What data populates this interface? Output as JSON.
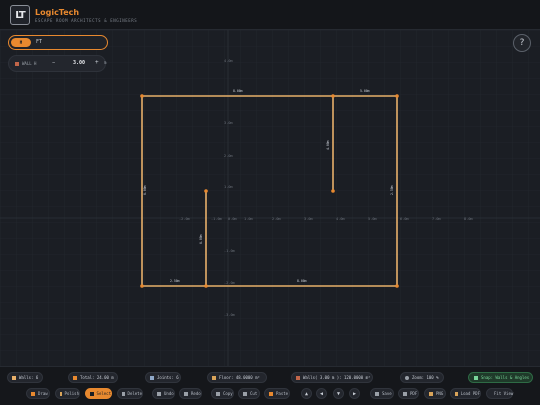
{
  "app": {
    "logo_text": "LT",
    "name": "LogicTech",
    "subtitle": "ESCAPE ROOM ARCHITECTS & ENGINEERS"
  },
  "mode": {
    "active_tab": "M",
    "unit": "FT"
  },
  "help": {
    "label": "?"
  },
  "wall_control": {
    "label": "WALL H",
    "minus": "−",
    "value": "3.00",
    "plus": "+",
    "unit": "m"
  },
  "canvas": {
    "axis_labels": [
      "-2.0m",
      "-1.0m",
      "0.0m",
      "1.0m",
      "2.0m",
      "3.0m",
      "4.0m",
      "5.0m",
      "6.0m",
      "7.0m",
      "8.0m"
    ],
    "vertical_labels": [
      "4.0m",
      "3.0m",
      "2.0m",
      "1.0m",
      "-1.0m",
      "-2.0m",
      "-3.0m"
    ],
    "wall_labels": [
      "8.00m",
      "5.00m",
      "4.00m",
      "2.50m",
      "6.00m",
      "1.00m",
      "8.00m",
      "6.00m",
      "2.00m",
      "2.50m"
    ]
  },
  "stats": {
    "walls": "Walls: 6",
    "total": "Total: 24.00 m",
    "joints": "Joints: 6",
    "floor": "Floor: 48.0000 m²",
    "wall_area": "Walls( 3.00 m ): 120.0000 m²",
    "zoom": "Zoom: 100 %",
    "snap": "Snap: Walls & Angles"
  },
  "toolbar": {
    "draw": "Draw",
    "polish": "Polish",
    "select": "Select",
    "delete": "Delete",
    "undo": "Undo",
    "redo": "Redo",
    "copy": "Copy",
    "cut": "Cut",
    "paste": "Paste",
    "up": "▲",
    "left": "◀",
    "down": "▼",
    "right": "▶",
    "save": "Save",
    "pdf": "PDF",
    "png": "PNG",
    "load_pdf": "Load PDF",
    "fit_view": "Fit View"
  },
  "colors": {
    "accent": "#e8892f",
    "wall": "#e8b06a",
    "snap": "#79d59a",
    "background": "#1b1e24"
  },
  "icons": [
    "logo-icon",
    "help-icon",
    "wall-icon",
    "ruler-icon",
    "pencil-icon",
    "joint-icon",
    "floor-icon",
    "area-icon",
    "zoom-icon",
    "snap-icon",
    "arrow-icons"
  ]
}
